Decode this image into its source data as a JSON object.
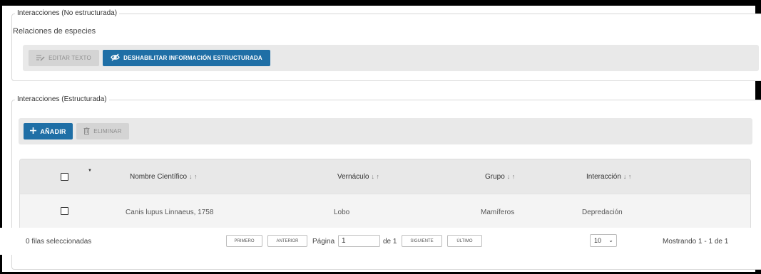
{
  "panel_unstructured": {
    "legend": "Interacciones (No estructurada)",
    "subtitle": "Relaciones de especies",
    "edit_button": "EDITAR TEXTO",
    "disable_button": "DESHABILITAR INFORMACIÓN ESTRUCTURADA"
  },
  "panel_structured": {
    "legend": "Interacciones (Estructurada)",
    "add_button": "AÑADIR",
    "delete_button": "ELIMINAR"
  },
  "grid": {
    "sort_glyph": "↓ ↑",
    "columns": [
      "Nombre Científico",
      "Vernáculo",
      "Grupo",
      "Interacción"
    ],
    "rows": [
      [
        "Canis lupus Linnaeus, 1758",
        "Lobo",
        "Mamíferos",
        "Depredación"
      ]
    ]
  },
  "pager": {
    "selected_text": "0 filas seleccionadas",
    "first": "PRIMERO",
    "previous": "ANTERIOR",
    "page_label": "Página",
    "page_value": "1",
    "of_label": "de 1",
    "next": "SIGUIENTE",
    "last": "ÚLTIMO",
    "page_size": "10",
    "showing": "Mostrando 1 - 1 de 1"
  },
  "icons": {
    "edit": "edit-text-icon",
    "disable": "eye-off-icon",
    "add": "plus-icon",
    "delete": "trash-icon"
  },
  "colors": {
    "primary": "#1f6fa6",
    "disabled_bg": "#d4d4d4",
    "toolbar_bg": "#e9e9e9",
    "header_bg": "#e8e8e8"
  }
}
